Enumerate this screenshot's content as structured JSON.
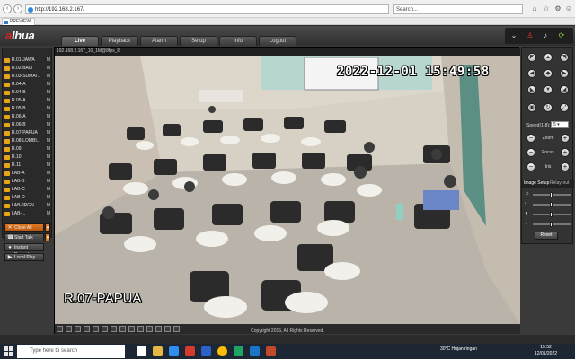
{
  "browser": {
    "url": "http://192.168.2.167/",
    "search_placeholder": "Search...",
    "tab_label": "PREVIEW"
  },
  "app": {
    "logo_text": "alhua",
    "tabs": [
      {
        "label": "Live",
        "active": true
      },
      {
        "label": "Playback",
        "active": false
      },
      {
        "label": "Alarm",
        "active": false
      },
      {
        "label": "Setup",
        "active": false
      },
      {
        "label": "Info",
        "active": false
      },
      {
        "label": "Logout",
        "active": false
      }
    ],
    "header_icons": [
      "chevron-down-icon",
      "person-icon",
      "microphone-icon",
      "fullscreen-icon"
    ]
  },
  "channels": [
    {
      "label": "R.01-JAWA",
      "mark": "M"
    },
    {
      "label": "R.02-BALI",
      "mark": "M"
    },
    {
      "label": "R.03-SUMAT..",
      "mark": "M"
    },
    {
      "label": "R.04-A",
      "mark": "M"
    },
    {
      "label": "R.04-B",
      "mark": "M"
    },
    {
      "label": "R.05-A",
      "mark": "M"
    },
    {
      "label": "R.05-B",
      "mark": "M"
    },
    {
      "label": "R.06-A",
      "mark": "M"
    },
    {
      "label": "R.06-B",
      "mark": "M"
    },
    {
      "label": "R.07-PAPUA",
      "mark": "M"
    },
    {
      "label": "R.08-LOMBI..",
      "mark": "M"
    },
    {
      "label": "R.09",
      "mark": "M"
    },
    {
      "label": "R.10",
      "mark": "M"
    },
    {
      "label": "R.11",
      "mark": "M"
    },
    {
      "label": "LAB-A",
      "mark": "M"
    },
    {
      "label": "LAB-B",
      "mark": "M"
    },
    {
      "label": "LAB-C",
      "mark": "M"
    },
    {
      "label": "LAB-D",
      "mark": "M"
    },
    {
      "label": "LAB-JRGN",
      "mark": "M"
    },
    {
      "label": "LAB-...",
      "mark": "M"
    }
  ],
  "panel_buttons": {
    "close_all": "Close All",
    "start_talk": "Start Talk",
    "instant_record": "Instant Record",
    "local_play": "Local Play"
  },
  "video": {
    "info_bar": "192.168.2.167_10_1M@8fps_R",
    "timestamp": "2022-12-01  15:49:58",
    "camera_name": "R.07-PAPUA"
  },
  "ptz": {
    "speed_label": "Speed(1-8):",
    "speed_value": "5",
    "zoom_label": "Zoom",
    "focus_label": "Focus",
    "iris_label": "Iris"
  },
  "image_setup": {
    "tab_image": "Image Setup",
    "tab_relay": "Relay-out",
    "sliders": [
      {
        "icon": "brightness-icon",
        "level": 0.5
      },
      {
        "icon": "contrast-icon",
        "level": 0.5
      },
      {
        "icon": "saturation-icon",
        "level": 0.5
      },
      {
        "icon": "hue-icon",
        "level": 0.5
      }
    ],
    "reset_label": "Reset"
  },
  "footer": {
    "copyright": "Copyright 2015, All Rights Reserved."
  },
  "taskbar": {
    "search_placeholder": "Type here to search",
    "weather": "30°C  Hujan ringan",
    "time": "15:52",
    "date": "12/01/2022"
  }
}
